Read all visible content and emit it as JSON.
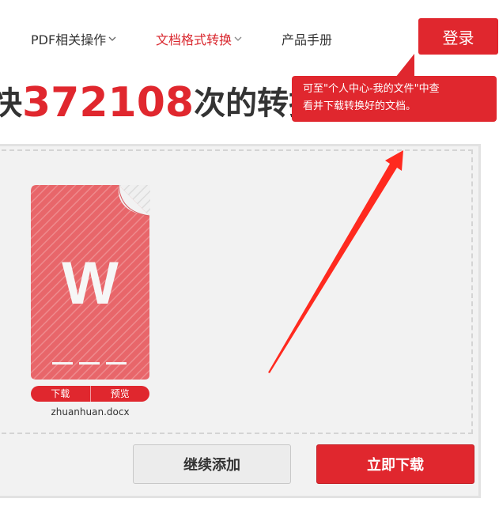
{
  "nav": {
    "items": [
      {
        "label": "PDF相关操作",
        "has_dropdown": true,
        "active": false
      },
      {
        "label": "文档格式转换",
        "has_dropdown": true,
        "active": true
      },
      {
        "label": "产品手册",
        "has_dropdown": false,
        "active": false
      }
    ],
    "login_label": "登录"
  },
  "headline": {
    "prefix": "快",
    "count": "372108",
    "suffix": "次的转换"
  },
  "tooltip": {
    "line1": "可至\"个人中心-我的文件\"中查",
    "line2": "看并下载转换好的文档。"
  },
  "file": {
    "icon_letter": "W",
    "name": "zhuanhuan.docx",
    "download_label": "下载",
    "preview_label": "预览"
  },
  "actions": {
    "add_label": "继续添加",
    "download_label": "立即下载"
  },
  "colors": {
    "accent": "#e0272e",
    "file_icon": "#e8666a",
    "panel_bg": "#f2f2f2"
  }
}
